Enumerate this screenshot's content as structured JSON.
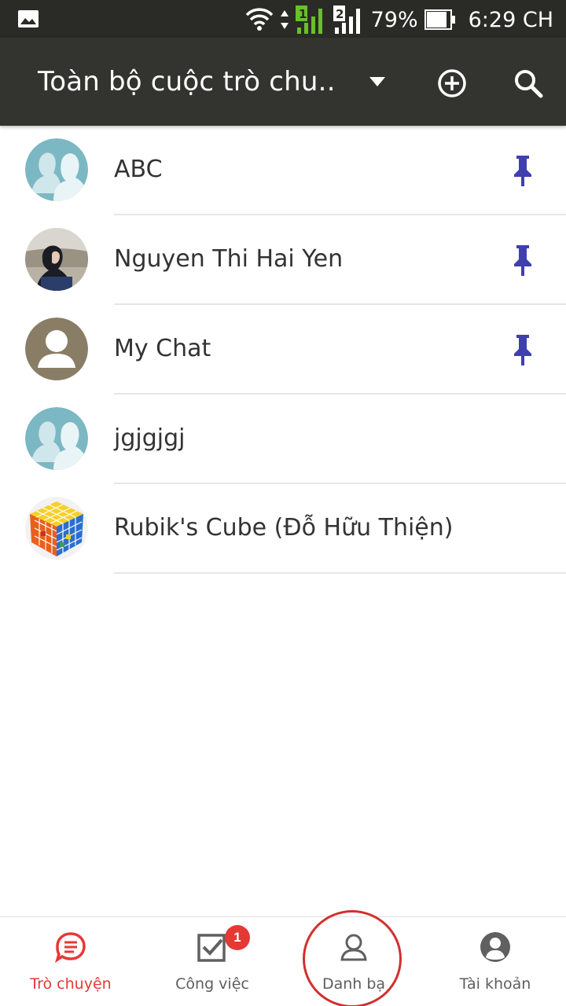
{
  "status_bar": {
    "battery_percent": "79%",
    "time": "6:29 CH",
    "sim1": "1",
    "sim2": "2"
  },
  "app_bar": {
    "title": "Toàn bộ cuộc trò chu..",
    "icons": [
      "dropdown-arrow-icon",
      "add-circle-icon",
      "search-icon"
    ]
  },
  "chats": [
    {
      "name": "ABC",
      "pinned": true,
      "avatar": "group-avatar"
    },
    {
      "name": "Nguyen Thi Hai Yen",
      "pinned": true,
      "avatar": "photo-avatar"
    },
    {
      "name": "My Chat",
      "pinned": true,
      "avatar": "person-avatar"
    },
    {
      "name": "jgjgjgj",
      "pinned": false,
      "avatar": "group-avatar"
    },
    {
      "name": "Rubik's Cube (Đỗ Hữu Thiện)",
      "pinned": false,
      "avatar": "rubik-avatar"
    }
  ],
  "bottom_nav": {
    "items": [
      {
        "label": "Trò chuyện",
        "icon": "chat-icon",
        "active": true
      },
      {
        "label": "Công việc",
        "icon": "task-icon",
        "badge": "1"
      },
      {
        "label": "Danh bạ",
        "icon": "contacts-icon"
      },
      {
        "label": "Tài khoản",
        "icon": "account-icon"
      }
    ]
  },
  "colors": {
    "status_bar": "#2a2b26",
    "app_bar": "#333430",
    "accent": "#e53935",
    "pin": "#3f3fb0",
    "group_avatar": "#7cb7c4"
  }
}
